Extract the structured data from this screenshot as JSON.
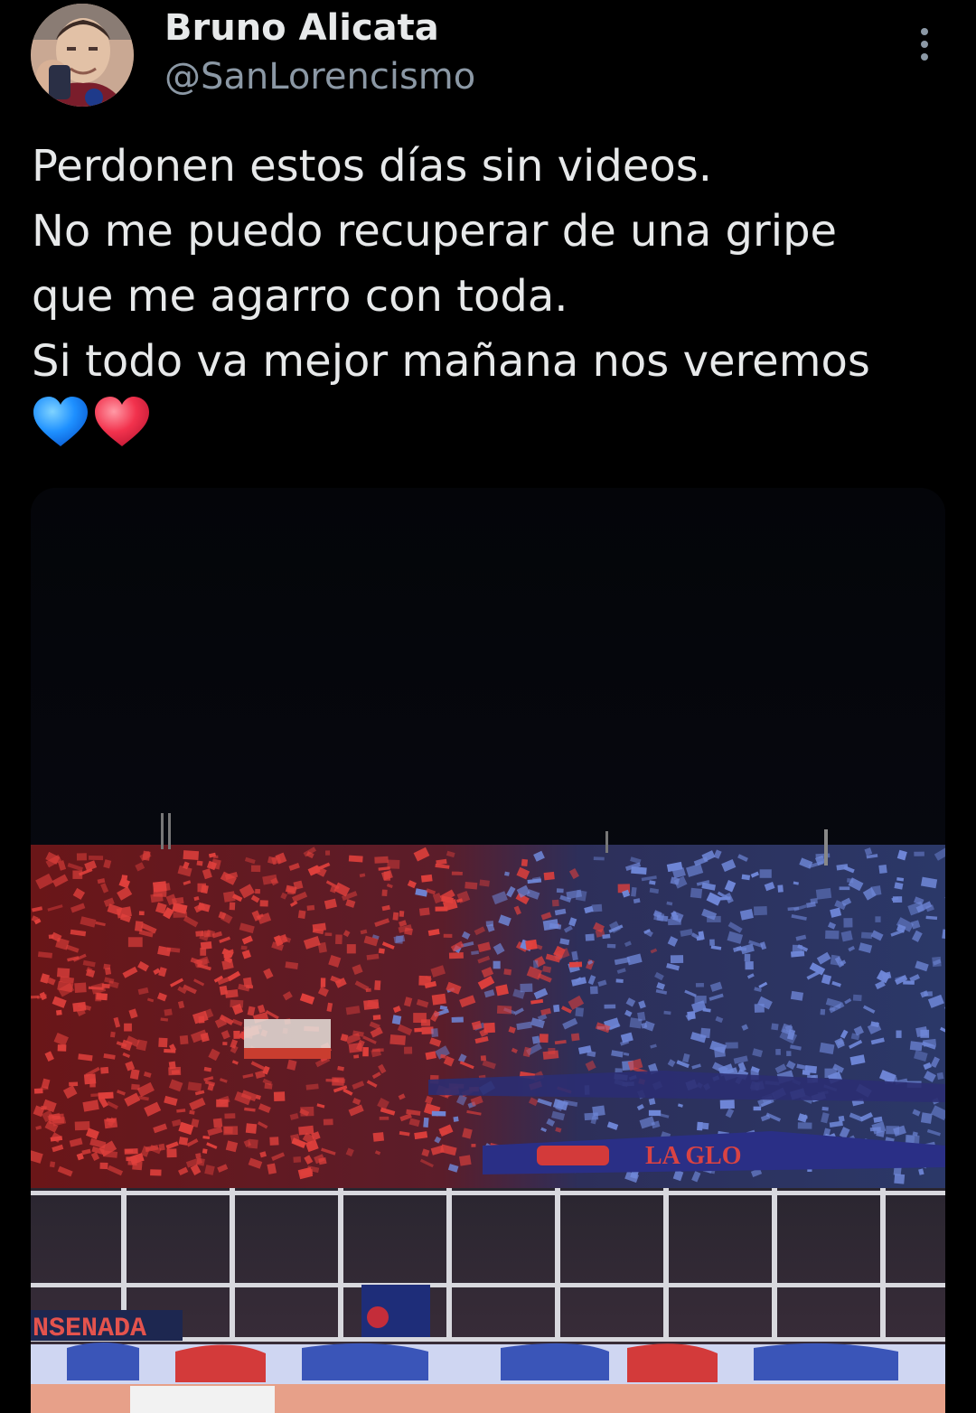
{
  "tweet": {
    "author": {
      "display_name": "Bruno Alicata",
      "handle": "@SanLorencismo"
    },
    "text_lines": [
      "Perdonen estos días sin videos.",
      "No me puedo recuperar de una gripe",
      "que me agarro con toda.",
      "Si todo va mejor mañana nos veremos"
    ],
    "emojis": [
      "blue-heart-icon",
      "red-heart-icon"
    ],
    "menu_icon": "more-vertical-icon",
    "media": {
      "kind": "photo",
      "banner_text": "LA GLO",
      "ad_text": "NSENADA",
      "colors": {
        "red": "#e0403c",
        "blue": "#6f87d8",
        "sky": "#05060c"
      }
    }
  }
}
